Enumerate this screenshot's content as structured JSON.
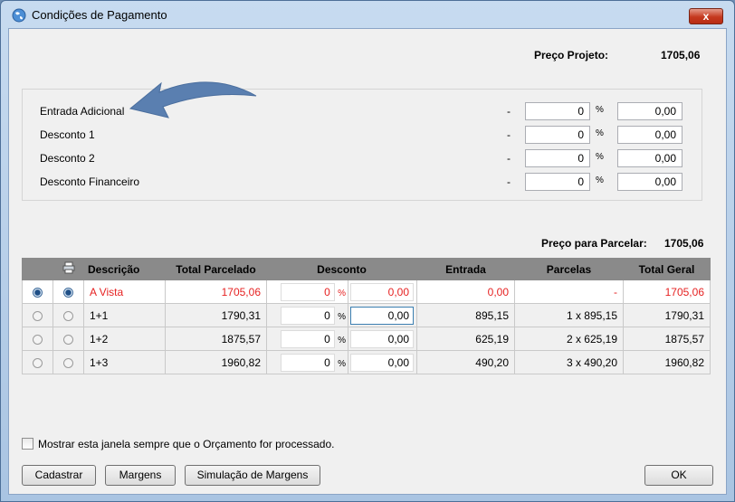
{
  "window": {
    "title": "Condições de Pagamento",
    "close_label": "x"
  },
  "header": {
    "preco_projeto_label": "Preço Projeto:",
    "preco_projeto_value": "1705,06"
  },
  "adjustments": [
    {
      "label": "Entrada Adicional",
      "dash": "-",
      "pct": "0",
      "pct_sign": "%",
      "value": "0,00"
    },
    {
      "label": "Desconto 1",
      "dash": "-",
      "pct": "0",
      "pct_sign": "%",
      "value": "0,00"
    },
    {
      "label": "Desconto 2",
      "dash": "-",
      "pct": "0",
      "pct_sign": "%",
      "value": "0,00"
    },
    {
      "label": "Desconto Financeiro",
      "dash": "-",
      "pct": "0",
      "pct_sign": "%",
      "value": "0,00"
    }
  ],
  "parcelar": {
    "label": "Preço para Parcelar:",
    "value": "1705,06"
  },
  "grid": {
    "columns": [
      "Descrição",
      "Total Parcelado",
      "Desconto",
      "Entrada",
      "Parcelas",
      "Total Geral"
    ],
    "rows": [
      {
        "descricao": "A Vista",
        "total_parcelado": "1705,06",
        "desc_pct": "0",
        "pct_sign": "%",
        "desc_val": "0,00",
        "entrada": "0,00",
        "parcelas": "-",
        "total_geral": "1705,06"
      },
      {
        "descricao": "1+1",
        "total_parcelado": "1790,31",
        "desc_pct": "0",
        "pct_sign": "%",
        "desc_val": "0,00",
        "entrada": "895,15",
        "parcelas": "1 x 895,15",
        "total_geral": "1790,31"
      },
      {
        "descricao": "1+2",
        "total_parcelado": "1875,57",
        "desc_pct": "0",
        "pct_sign": "%",
        "desc_val": "0,00",
        "entrada": "625,19",
        "parcelas": "2 x 625,19",
        "total_geral": "1875,57"
      },
      {
        "descricao": "1+3",
        "total_parcelado": "1960,82",
        "desc_pct": "0",
        "pct_sign": "%",
        "desc_val": "0,00",
        "entrada": "490,20",
        "parcelas": "3 x 490,20",
        "total_geral": "1960,82"
      }
    ]
  },
  "footer": {
    "checkbox_label": "Mostrar esta janela sempre que o Orçamento for processado.",
    "buttons": {
      "cadastrar": "Cadastrar",
      "margens": "Margens",
      "simulacao": "Simulação de Margens",
      "ok": "OK"
    }
  },
  "colors": {
    "accent_red": "#e62222",
    "header_gray": "#8a8a8a",
    "arrow_blue": "#5a7fb0"
  }
}
